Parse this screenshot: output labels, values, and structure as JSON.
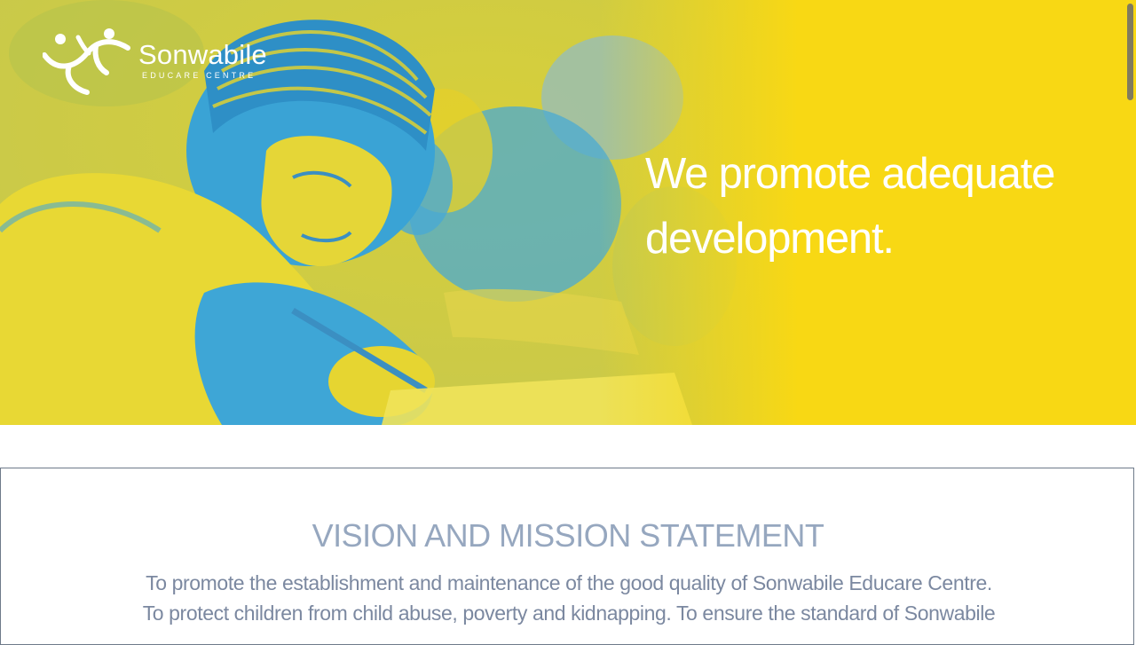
{
  "logo": {
    "name": "Sonwabile",
    "subtitle": "EDUCARE CENTRE",
    "icon": "children-figures-icon"
  },
  "hero": {
    "heading": "We promote adequate development.",
    "image": "student-writing-photo",
    "colors": {
      "yellow": "#f8d814",
      "blue": "#3ba4d4"
    }
  },
  "vision": {
    "title": "VISION AND MISSION STATEMENT",
    "text": "To promote the establishment and maintenance of the good quality of Sonwabile Educare Centre. To protect children from child abuse, poverty and kidnapping. To ensure the standard of Sonwabile"
  }
}
